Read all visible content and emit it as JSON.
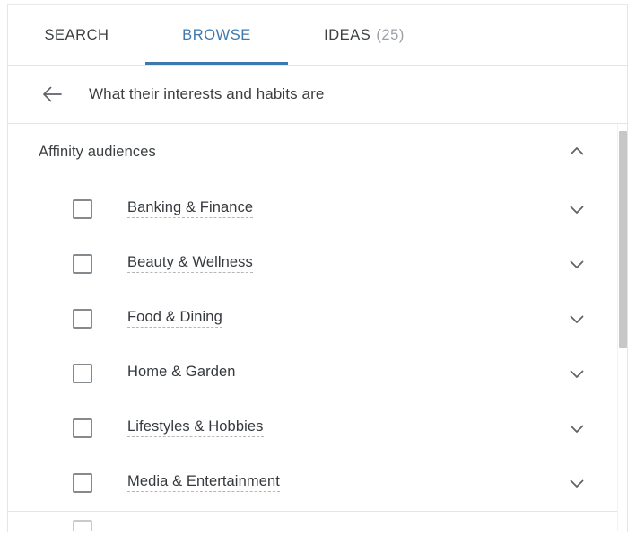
{
  "tabs": [
    {
      "label": "SEARCH",
      "active": false,
      "count": ""
    },
    {
      "label": "BROWSE",
      "active": true,
      "count": ""
    },
    {
      "label": "IDEAS",
      "active": false,
      "count": "(25)"
    }
  ],
  "header": {
    "back_icon": "arrow-left-icon",
    "title": "What their interests and habits are"
  },
  "group": {
    "title": "Affinity audiences",
    "collapse_icon": "chevron-up-icon",
    "expanded": true
  },
  "rows": [
    {
      "label": "Banking & Finance",
      "checked": false,
      "expand_icon": "chevron-down-icon"
    },
    {
      "label": "Beauty & Wellness",
      "checked": false,
      "expand_icon": "chevron-down-icon"
    },
    {
      "label": "Food & Dining",
      "checked": false,
      "expand_icon": "chevron-down-icon"
    },
    {
      "label": "Home & Garden",
      "checked": false,
      "expand_icon": "chevron-down-icon"
    },
    {
      "label": "Lifestyles & Hobbies",
      "checked": false,
      "expand_icon": "chevron-down-icon"
    },
    {
      "label": "Media & Entertainment",
      "checked": false,
      "expand_icon": "chevron-down-icon"
    }
  ],
  "colors": {
    "accent": "#3d79ae",
    "text_primary": "#3c4043",
    "text_muted": "#9aa0a6",
    "border": "#e4e5e7",
    "checkbox_border": "#858a8f",
    "scrollbar_thumb": "#c6c7c9"
  },
  "scrollbar": {
    "name": "vertical-scrollbar"
  }
}
